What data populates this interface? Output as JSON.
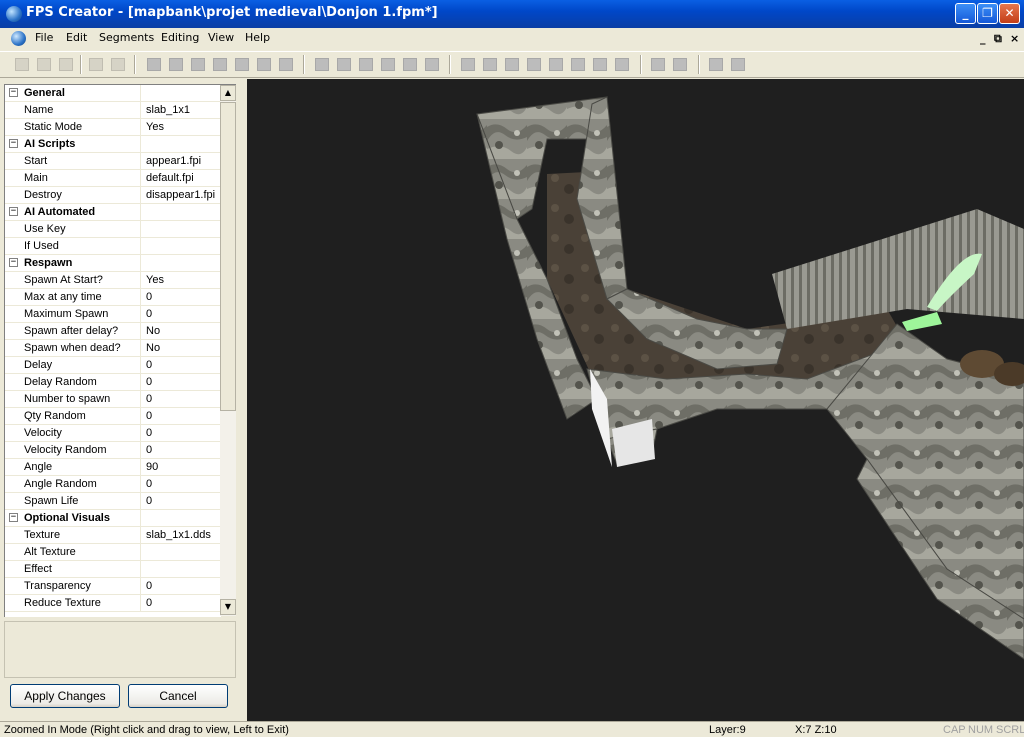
{
  "window": {
    "title": "FPS Creator - [mapbank\\projet medieval\\Donjon 1.fpm*]"
  },
  "menu": {
    "items": [
      "File",
      "Edit",
      "Segments",
      "Editing",
      "View",
      "Help"
    ],
    "mdi_minimize": "_",
    "mdi_restore": "⧉",
    "mdi_close": "×"
  },
  "properties": {
    "rows": [
      {
        "section": true,
        "name": "General",
        "value": ""
      },
      {
        "name": "Name",
        "value": "slab_1x1"
      },
      {
        "name": "Static Mode",
        "value": "Yes"
      },
      {
        "section": true,
        "name": "AI Scripts",
        "value": ""
      },
      {
        "name": "Start",
        "value": "appear1.fpi"
      },
      {
        "name": "Main",
        "value": "default.fpi"
      },
      {
        "name": "Destroy",
        "value": "disappear1.fpi"
      },
      {
        "section": true,
        "name": "AI Automated",
        "value": ""
      },
      {
        "name": "Use Key",
        "value": ""
      },
      {
        "name": "If Used",
        "value": ""
      },
      {
        "section": true,
        "name": "Respawn",
        "value": ""
      },
      {
        "name": "Spawn At Start?",
        "value": "Yes"
      },
      {
        "name": "Max at any time",
        "value": "0"
      },
      {
        "name": "Maximum Spawn",
        "value": "0"
      },
      {
        "name": "Spawn after delay?",
        "value": "No"
      },
      {
        "name": "Spawn when dead?",
        "value": "No"
      },
      {
        "name": "Delay",
        "value": "0"
      },
      {
        "name": "Delay Random",
        "value": "0"
      },
      {
        "name": "Number to spawn",
        "value": "0"
      },
      {
        "name": "Qty Random",
        "value": "0"
      },
      {
        "name": "Velocity",
        "value": "0"
      },
      {
        "name": "Velocity Random",
        "value": "0"
      },
      {
        "name": "Angle",
        "value": "90"
      },
      {
        "name": "Angle Random",
        "value": "0"
      },
      {
        "name": "Spawn Life",
        "value": "0"
      },
      {
        "section": true,
        "name": "Optional Visuals",
        "value": ""
      },
      {
        "name": "Texture",
        "value": "slab_1x1.dds"
      },
      {
        "name": "Alt Texture",
        "value": ""
      },
      {
        "name": "Effect",
        "value": ""
      },
      {
        "name": "Transparency",
        "value": "0"
      },
      {
        "name": "Reduce Texture",
        "value": "0"
      }
    ]
  },
  "buttons": {
    "apply": "Apply Changes",
    "cancel": "Cancel"
  },
  "status": {
    "mode": "Zoomed In Mode (Right click and drag to view, Left to Exit)",
    "layer": "Layer:9",
    "coords": "X:7  Z:10",
    "cap": "CAP",
    "num": "NUM",
    "scrl": "SCRL"
  }
}
